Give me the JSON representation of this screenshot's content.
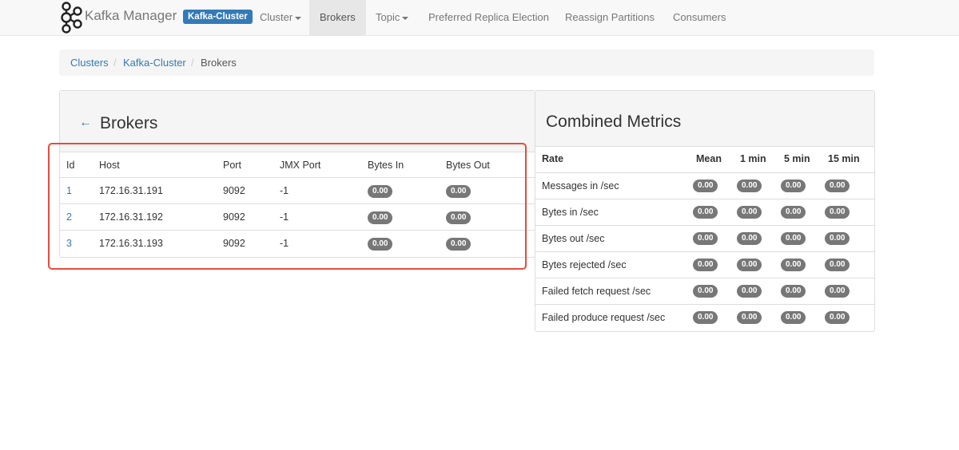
{
  "navbar": {
    "brand": "Kafka Manager",
    "cluster_badge": "Kafka-Cluster",
    "items": [
      {
        "label": "Cluster",
        "dropdown": true
      },
      {
        "label": "Brokers",
        "active": true
      },
      {
        "label": "Topic",
        "dropdown": true
      },
      {
        "label": "Preferred Replica Election"
      },
      {
        "label": "Reassign Partitions"
      },
      {
        "label": "Consumers"
      }
    ]
  },
  "breadcrumb": {
    "items": [
      "Clusters",
      "Kafka-Cluster",
      "Brokers"
    ],
    "separator": "/"
  },
  "brokers": {
    "title": "Brokers",
    "columns": [
      "Id",
      "Host",
      "Port",
      "JMX Port",
      "Bytes In",
      "Bytes Out"
    ],
    "rows": [
      {
        "id": "1",
        "host": "172.16.31.191",
        "port": "9092",
        "jmx_port": "-1",
        "bytes_in": "0.00",
        "bytes_out": "0.00"
      },
      {
        "id": "2",
        "host": "172.16.31.192",
        "port": "9092",
        "jmx_port": "-1",
        "bytes_in": "0.00",
        "bytes_out": "0.00"
      },
      {
        "id": "3",
        "host": "172.16.31.193",
        "port": "9092",
        "jmx_port": "-1",
        "bytes_in": "0.00",
        "bytes_out": "0.00"
      }
    ]
  },
  "metrics": {
    "title": "Combined Metrics",
    "columns": [
      "Rate",
      "Mean",
      "1 min",
      "5 min",
      "15 min"
    ],
    "rows": [
      {
        "rate": "Messages in /sec",
        "mean": "0.00",
        "m1": "0.00",
        "m5": "0.00",
        "m15": "0.00"
      },
      {
        "rate": "Bytes in /sec",
        "mean": "0.00",
        "m1": "0.00",
        "m5": "0.00",
        "m15": "0.00"
      },
      {
        "rate": "Bytes out /sec",
        "mean": "0.00",
        "m1": "0.00",
        "m5": "0.00",
        "m15": "0.00"
      },
      {
        "rate": "Bytes rejected /sec",
        "mean": "0.00",
        "m1": "0.00",
        "m5": "0.00",
        "m15": "0.00"
      },
      {
        "rate": "Failed fetch request /sec",
        "mean": "0.00",
        "m1": "0.00",
        "m5": "0.00",
        "m15": "0.00"
      },
      {
        "rate": "Failed produce request /sec",
        "mean": "0.00",
        "m1": "0.00",
        "m5": "0.00",
        "m15": "0.00"
      }
    ]
  },
  "colors": {
    "link": "#337ab7",
    "badge": "#337ab7",
    "pill": "#777777",
    "highlight_box": "#e74c3c"
  },
  "icons": {
    "logo": "kafka-logo-icon",
    "back": "arrow-left-icon",
    "dropdown": "caret-down-icon"
  }
}
